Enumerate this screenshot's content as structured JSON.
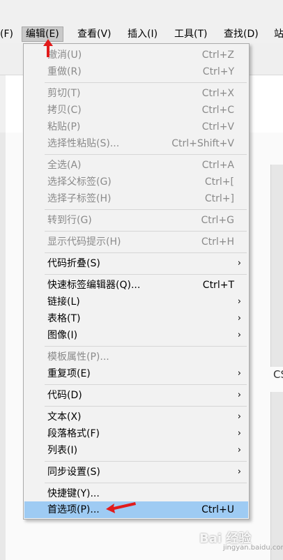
{
  "menubar": {
    "items": [
      {
        "label": "(F)"
      },
      {
        "label": "编辑(E)"
      },
      {
        "label": "查看(V)"
      },
      {
        "label": "插入(I)"
      },
      {
        "label": "工具(T)"
      },
      {
        "label": "查找(D)"
      },
      {
        "label": "站"
      }
    ]
  },
  "right_label": "CS",
  "menu": {
    "items": [
      {
        "label": "撤消(U)",
        "shortcut": "Ctrl+Z"
      },
      {
        "label": "重做(R)",
        "shortcut": "Ctrl+Y"
      },
      {
        "label": "剪切(T)",
        "shortcut": "Ctrl+X"
      },
      {
        "label": "拷贝(C)",
        "shortcut": "Ctrl+C"
      },
      {
        "label": "粘贴(P)",
        "shortcut": "Ctrl+V"
      },
      {
        "label": "选择性粘贴(S)...",
        "shortcut": "Ctrl+Shift+V"
      },
      {
        "label": "全选(A)",
        "shortcut": "Ctrl+A"
      },
      {
        "label": "选择父标签(G)",
        "shortcut": "Ctrl+["
      },
      {
        "label": "选择子标签(H)",
        "shortcut": "Ctrl+]"
      },
      {
        "label": "转到行(G)",
        "shortcut": "Ctrl+G"
      },
      {
        "label": "显示代码提示(H)",
        "shortcut": "Ctrl+H"
      },
      {
        "label": "代码折叠(S)",
        "arrow": "›"
      },
      {
        "label": "快速标签编辑器(Q)...",
        "shortcut": "Ctrl+T"
      },
      {
        "label": "链接(L)",
        "arrow": "›"
      },
      {
        "label": "表格(T)",
        "arrow": "›"
      },
      {
        "label": "图像(I)",
        "arrow": "›"
      },
      {
        "label": "模板属性(P)..."
      },
      {
        "label": "重复项(E)",
        "arrow": "›"
      },
      {
        "label": "代码(D)",
        "arrow": "›"
      },
      {
        "label": "文本(X)",
        "arrow": "›"
      },
      {
        "label": "段落格式(F)",
        "arrow": "›"
      },
      {
        "label": "列表(I)",
        "arrow": "›"
      },
      {
        "label": "同步设置(S)",
        "arrow": "›"
      },
      {
        "label": "快捷键(Y)..."
      },
      {
        "label": "首选项(P)...",
        "shortcut": "Ctrl+U"
      }
    ]
  },
  "watermark": {
    "text": "Bai 经验",
    "sub": "jingyan.baidu.com"
  },
  "colors": {
    "highlight": "#9ecbf3",
    "annotation_arrow": "#e11b1b",
    "disabled_text": "#8a8a8a"
  }
}
